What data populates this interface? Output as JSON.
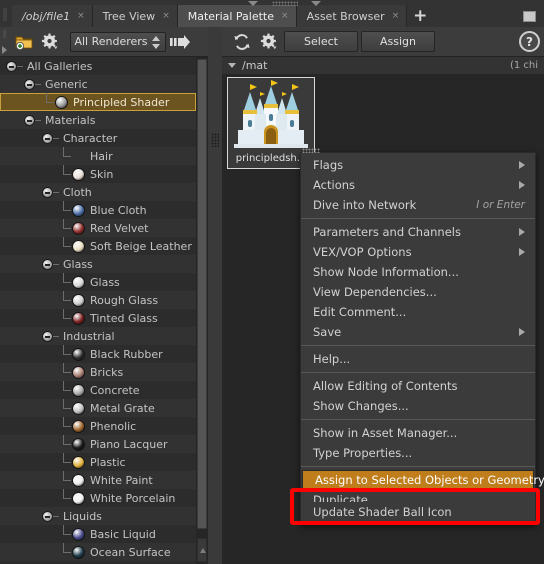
{
  "window": {
    "tabs": [
      {
        "label": "/obj/file1",
        "italic": true,
        "active": false,
        "close": "×"
      },
      {
        "label": "Tree View",
        "italic": false,
        "active": false,
        "close": "×"
      },
      {
        "label": "Material Palette",
        "italic": false,
        "active": true,
        "close": "×"
      },
      {
        "label": "Asset Browser",
        "italic": false,
        "active": false,
        "close": "×"
      }
    ],
    "add_tab": "+"
  },
  "left_toolbar": {
    "new_gallery_icon": "folder-add-icon",
    "gear_icon": "gear-icon",
    "renderer_filter": "All Renderers",
    "jump_icon": "jump-to-icon"
  },
  "tree": {
    "rows": [
      {
        "label": "All Galleries",
        "depth": 0,
        "kind": "group",
        "expanded": true,
        "selected": false
      },
      {
        "label": "Generic",
        "depth": 1,
        "kind": "group",
        "expanded": true,
        "selected": false
      },
      {
        "label": "Principled Shader",
        "depth": 2,
        "kind": "item",
        "color": "#9a9a9a",
        "selected": true
      },
      {
        "label": "Materials",
        "depth": 1,
        "kind": "group",
        "expanded": true,
        "selected": false
      },
      {
        "label": "Character",
        "depth": 2,
        "kind": "group",
        "expanded": true,
        "selected": false
      },
      {
        "label": "Hair",
        "depth": 3,
        "kind": "item",
        "color": "#2a2a2a",
        "selected": false
      },
      {
        "label": "Skin",
        "depth": 3,
        "kind": "item",
        "color": "#e8ded7",
        "selected": false
      },
      {
        "label": "Cloth",
        "depth": 2,
        "kind": "group",
        "expanded": true,
        "selected": false
      },
      {
        "label": "Blue Cloth",
        "depth": 3,
        "kind": "item",
        "color": "#4a6fa8",
        "selected": false
      },
      {
        "label": "Red Velvet",
        "depth": 3,
        "kind": "item",
        "color": "#8e2b28",
        "selected": false
      },
      {
        "label": "Soft Beige Leather",
        "depth": 3,
        "kind": "item",
        "color": "#e8ddc4",
        "selected": false
      },
      {
        "label": "Glass",
        "depth": 2,
        "kind": "group",
        "expanded": true,
        "selected": false
      },
      {
        "label": "Glass",
        "depth": 3,
        "kind": "item",
        "color": "#d6d6d6",
        "selected": false
      },
      {
        "label": "Rough Glass",
        "depth": 3,
        "kind": "item",
        "color": "#cfcfcf",
        "selected": false
      },
      {
        "label": "Tinted Glass",
        "depth": 3,
        "kind": "item",
        "color": "#7a1f1f",
        "selected": false
      },
      {
        "label": "Industrial",
        "depth": 2,
        "kind": "group",
        "expanded": true,
        "selected": false
      },
      {
        "label": "Black Rubber",
        "depth": 3,
        "kind": "item",
        "color": "#2e2e2e",
        "selected": false
      },
      {
        "label": "Bricks",
        "depth": 3,
        "kind": "item",
        "color": "#a97f72",
        "selected": false
      },
      {
        "label": "Concrete",
        "depth": 3,
        "kind": "item",
        "color": "#a8a8a8",
        "selected": false
      },
      {
        "label": "Metal Grate",
        "depth": 3,
        "kind": "item",
        "color": "#c0c0c0",
        "selected": false
      },
      {
        "label": "Phenolic",
        "depth": 3,
        "kind": "item",
        "color": "#a0652c",
        "selected": false
      },
      {
        "label": "Piano Lacquer",
        "depth": 3,
        "kind": "item",
        "color": "#1a1a1a",
        "selected": false
      },
      {
        "label": "Plastic",
        "depth": 3,
        "kind": "item",
        "color": "#e0b23a",
        "selected": false
      },
      {
        "label": "White Paint",
        "depth": 3,
        "kind": "item",
        "color": "#ececec",
        "selected": false
      },
      {
        "label": "White Porcelain",
        "depth": 3,
        "kind": "item",
        "color": "#f2f2f2",
        "selected": false
      },
      {
        "label": "Liquids",
        "depth": 2,
        "kind": "group",
        "expanded": true,
        "selected": false
      },
      {
        "label": "Basic Liquid",
        "depth": 3,
        "kind": "item",
        "color": "#4a4a8e",
        "selected": false
      },
      {
        "label": "Ocean Surface",
        "depth": 3,
        "kind": "item",
        "color": "#1d3b4a",
        "selected": false
      }
    ]
  },
  "right_toolbar": {
    "refresh_icon": "refresh-icon",
    "gear_icon": "gear-icon",
    "select_label": "Select",
    "assign_label": "Assign",
    "help_label": "?"
  },
  "palette": {
    "path": "/mat",
    "child_count": "(1 chi",
    "items": [
      {
        "name": "principledsh...",
        "icon": "castle-icon"
      }
    ]
  },
  "context_menu": {
    "items": [
      {
        "label": "Flags",
        "submenu": true
      },
      {
        "label": "Actions",
        "submenu": true
      },
      {
        "label": "Dive into Network",
        "accel": "I or Enter"
      },
      {
        "separator": true
      },
      {
        "label": "Parameters and Channels",
        "submenu": true
      },
      {
        "label": "VEX/VOP Options",
        "submenu": true
      },
      {
        "label": "Show Node Information..."
      },
      {
        "label": "View Dependencies..."
      },
      {
        "label": "Edit Comment..."
      },
      {
        "label": "Save",
        "submenu": true
      },
      {
        "separator": true
      },
      {
        "label": "Help..."
      },
      {
        "separator": true
      },
      {
        "label": "Allow Editing of Contents"
      },
      {
        "label": "Show Changes..."
      },
      {
        "separator": true
      },
      {
        "label": "Show in Asset Manager..."
      },
      {
        "label": "Type Properties..."
      },
      {
        "separator": true
      },
      {
        "label": "Assign to Selected Objects or Geometry",
        "highlight": true
      },
      {
        "label": "Duplicate",
        "clipped": true
      },
      {
        "label": "Update Shader Ball Icon"
      }
    ]
  },
  "annotation": {
    "highlight_color": "#ff0000",
    "target": "Assign to Selected Objects or Geometry"
  }
}
